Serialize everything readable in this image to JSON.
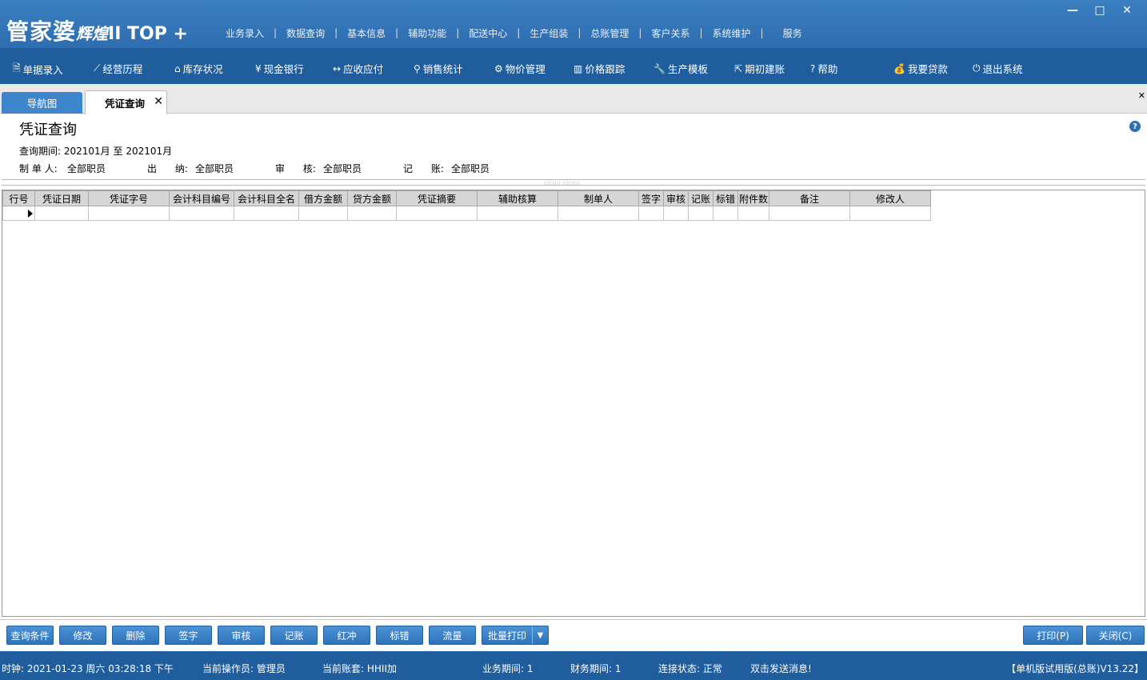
{
  "app": {
    "logo_main": "管家婆",
    "logo_sub": "辉煌",
    "logo_top": "II TOP +",
    "menu": [
      "业务录入",
      "数据查询",
      "基本信息",
      "辅助功能",
      "配送中心",
      "生产组装",
      "总账管理",
      "客户关系",
      "系统维护",
      "服务"
    ],
    "window_controls": [
      "minimize-icon",
      "maximize-icon",
      "close-icon"
    ]
  },
  "toolbar": [
    {
      "icon": "document-icon",
      "glyph": "🗎",
      "label": "单据录入"
    },
    {
      "icon": "chart-icon",
      "glyph": "⟋",
      "label": "经营历程"
    },
    {
      "icon": "home-icon",
      "glyph": "⌂",
      "label": "库存状况"
    },
    {
      "icon": "yen-icon",
      "glyph": "¥",
      "label": "现金银行"
    },
    {
      "icon": "swap-icon",
      "glyph": "↔",
      "label": "应收应付"
    },
    {
      "icon": "search-icon",
      "glyph": "⚲",
      "label": "销售统计"
    },
    {
      "icon": "gear-icon",
      "glyph": "⚙",
      "label": "物价管理"
    },
    {
      "icon": "bar-chart-icon",
      "glyph": "▥",
      "label": "价格跟踪"
    },
    {
      "icon": "wrench-icon",
      "glyph": "🔧",
      "label": "生产模板"
    },
    {
      "icon": "external-link-icon",
      "glyph": "⇱",
      "label": "期初建账"
    },
    {
      "icon": "question-icon",
      "glyph": "?",
      "label": "帮助"
    },
    {
      "icon": "moneybag-icon",
      "glyph": "💰",
      "label": "我要贷款"
    },
    {
      "icon": "power-icon",
      "glyph": "⏻",
      "label": "退出系统"
    }
  ],
  "tabs": {
    "nav_label": "导航图",
    "active_label": "凭证查询",
    "close_glyph": "✕",
    "close_all_glyph": "✕"
  },
  "page": {
    "title": "凭证查询",
    "help_glyph": "?",
    "period_label": "查询期间:",
    "period_value": "202101月 至 202101月",
    "maker_label": "制 单 人:",
    "maker_value": "全部职员",
    "cashier_label": "出      纳:",
    "cashier_value": "全部职员",
    "auditor_label": "审      核:",
    "auditor_value": "全部职员",
    "poster_label": "记      账:",
    "poster_value": "全部职员"
  },
  "grid": {
    "columns": [
      "行号",
      "凭证日期",
      "凭证字号",
      "会计科目编号",
      "会计科目全名",
      "借方金额",
      "贷方金额",
      "凭证摘要",
      "辅助核算",
      "制单人",
      "签字",
      "审核",
      "记账",
      "标错",
      "附件数",
      "备注",
      "修改人"
    ],
    "rows": [
      [
        "",
        "",
        "",
        "",
        "",
        "",
        "",
        "",
        "",
        "",
        "",
        "",
        "",
        "",
        "",
        "",
        ""
      ]
    ]
  },
  "buttons": {
    "query": "查询条件",
    "edit": "修改",
    "delete": "删除",
    "sign": "签字",
    "audit": "审核",
    "post": "记账",
    "red_reverse": "红冲",
    "mark_error": "标错",
    "flow": "流量",
    "batch_print": "批量打印",
    "batch_print_drop": "▼",
    "print": "打印(P)",
    "close": "关闭(C)"
  },
  "status": {
    "clock": "时钟: 2021-01-23 周六 03:28:18 下午",
    "operator": "当前操作员: 管理员",
    "account": "当前账套: HHII加",
    "biz_period": "业务期间: 1",
    "fin_period": "财务期间: 1",
    "connection": "连接状态: 正常",
    "message": "双击发送消息!",
    "version": "【单机版试用版(总账)V13.22】"
  }
}
